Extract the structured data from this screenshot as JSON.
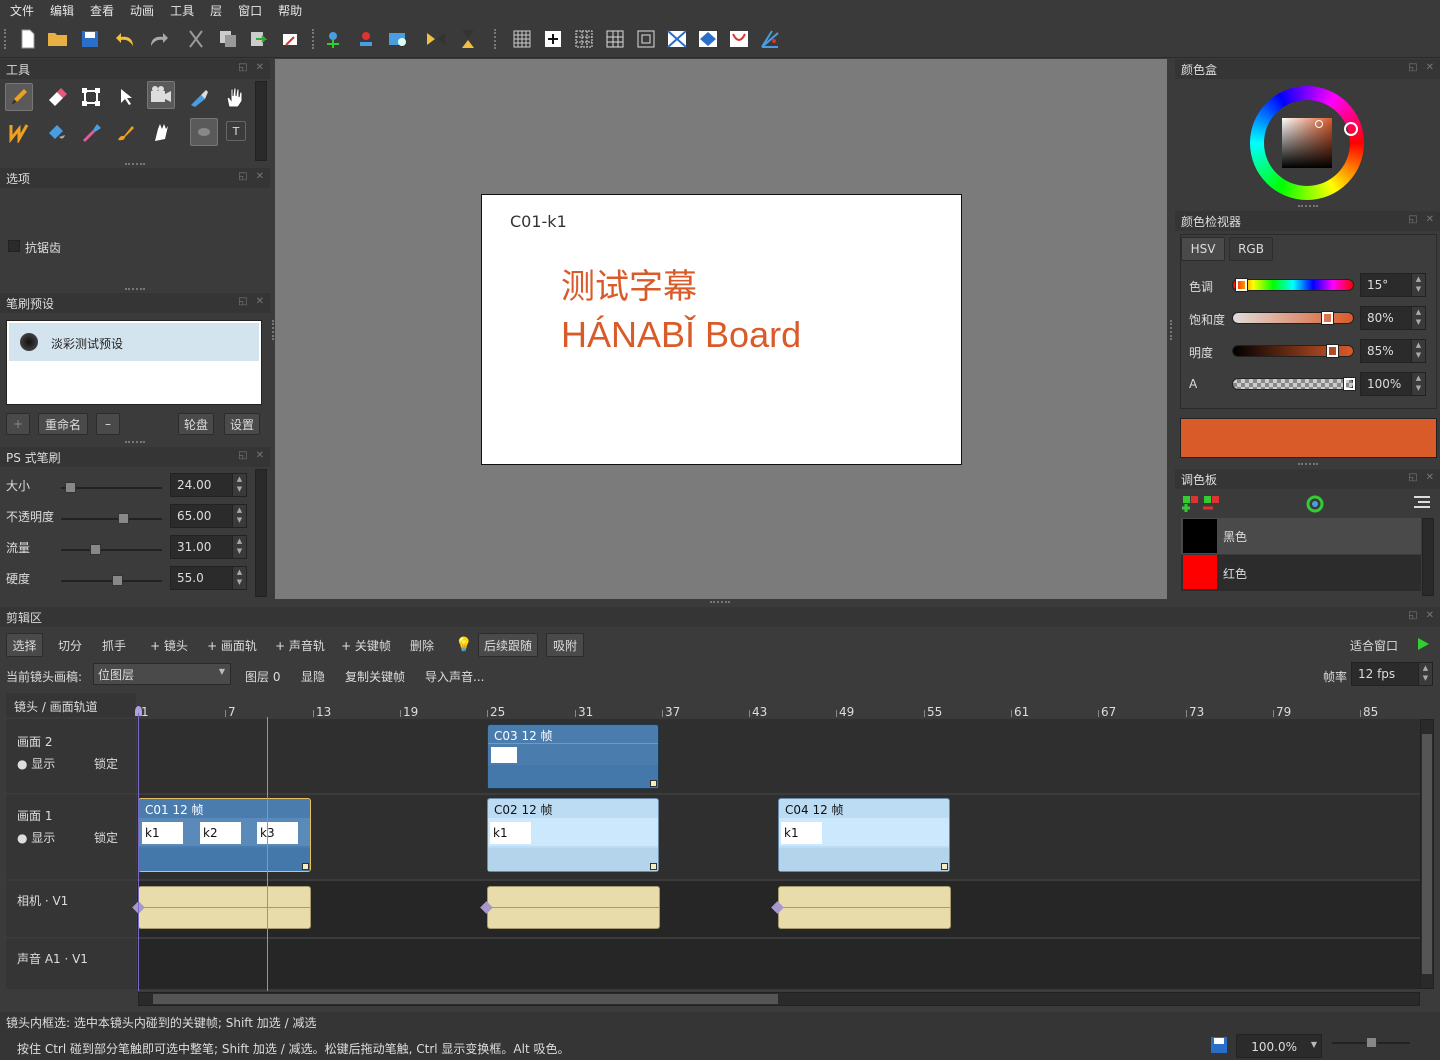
{
  "menu": [
    "文件",
    "编辑",
    "查看",
    "动画",
    "工具",
    "层",
    "窗口",
    "帮助"
  ],
  "panels": {
    "tools": {
      "title": "工具"
    },
    "options": {
      "title": "选项",
      "antialias": "抗锯齿"
    },
    "brush_presets": {
      "title": "笔刷预设",
      "preset": "淡彩测试预设",
      "add": "+",
      "rename": "重命名",
      "remove": "–",
      "wheel": "轮盘",
      "settings": "设置"
    },
    "ps_brush": {
      "title": "PS 式笔刷",
      "params": [
        {
          "label": "大小",
          "value": "24.00",
          "level": 0.04
        },
        {
          "label": "不透明度",
          "value": "65.00",
          "level": 0.62
        },
        {
          "label": "流量",
          "value": "31.00",
          "level": 0.31
        },
        {
          "label": "硬度",
          "value": "55.0",
          "level": 0.55
        }
      ]
    },
    "color_box": {
      "title": "颜色盒"
    },
    "color_viewer": {
      "title": "颜色检视器",
      "tabs": [
        "HSV",
        "RGB"
      ],
      "rows": [
        {
          "label": "色调",
          "value": "15°",
          "level": 0.04
        },
        {
          "label": "饱和度",
          "value": "80%",
          "level": 0.8
        },
        {
          "label": "明度",
          "value": "85%",
          "level": 0.85
        },
        {
          "label": "A",
          "value": "100%",
          "level": 1.0
        }
      ],
      "current_color": "#d95b2a"
    },
    "palette": {
      "title": "调色板",
      "swatches": [
        {
          "name": "黑色",
          "color": "#000000"
        },
        {
          "name": "红色",
          "color": "#ff0000"
        }
      ]
    }
  },
  "canvas": {
    "label": "C01-k1",
    "line1": "测试字幕",
    "line2": "HÁNABǏ Board",
    "text_color": "#d95b2a"
  },
  "timeline": {
    "title": "剪辑区",
    "tools": [
      "选择",
      "切分",
      "抓手",
      "+ 镜头",
      "+ 画面轨",
      "+ 声音轨",
      "+ 关键帧",
      "删除",
      "后续跟随",
      "吸附"
    ],
    "fit_window": "适合窗口",
    "current_layer_label": "当前镜头画稿:",
    "current_layer_value": "位图层",
    "row2_buttons": [
      "图层 0",
      "显隐",
      "复制关键帧",
      "导入声音..."
    ],
    "fps_label": "帧率",
    "fps_value": "12 fps",
    "header": "镜头 / 画面轨道",
    "ruler": [
      "1",
      "7",
      "13",
      "19",
      "25",
      "31",
      "37",
      "43",
      "49",
      "55",
      "61",
      "67",
      "73",
      "79",
      "85"
    ],
    "tracks": [
      {
        "name": "画面 2",
        "show": "● 显示",
        "lock": "锁定"
      },
      {
        "name": "画面 1",
        "show": "● 显示",
        "lock": "锁定"
      },
      {
        "name": "相机 · V1"
      },
      {
        "name": "声音 A1 · V1"
      }
    ],
    "clips": {
      "c03": {
        "label": "C03   12 帧"
      },
      "c01": {
        "label": "C01   12 帧",
        "keys": [
          "k1",
          "k2",
          "k3"
        ]
      },
      "c02": {
        "label": "C02   12 帧",
        "keys": [
          "k1"
        ]
      },
      "c04": {
        "label": "C04   12 帧",
        "keys": [
          "k1"
        ]
      }
    }
  },
  "status": {
    "line1": "镜头内框选: 选中本镜头内碰到的关键帧; Shift 加选 / 减选",
    "line2": "按住 Ctrl 碰到部分笔触即可选中整笔; Shift 加选 / 减选。松键后拖动笔触, Ctrl 显示变换框。Alt 吸色。",
    "zoom": "100.0%"
  }
}
